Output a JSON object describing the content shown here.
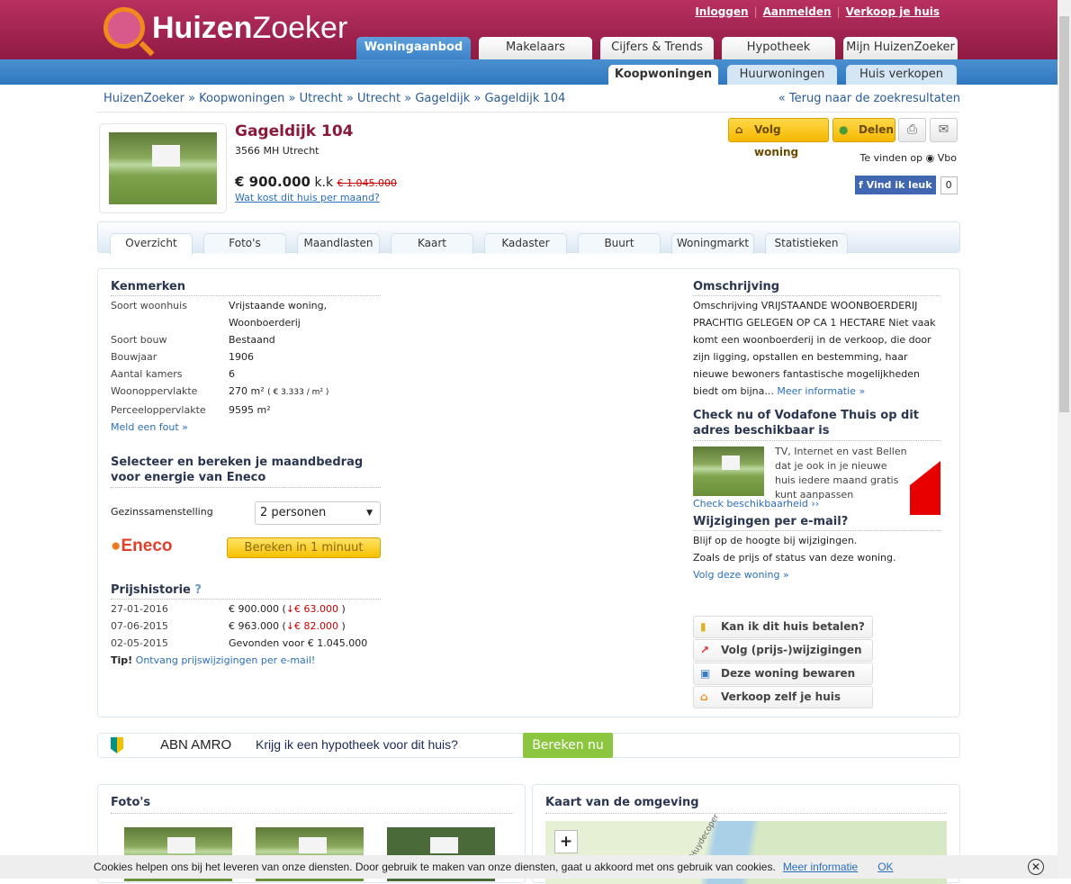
{
  "brand": {
    "name_bold": "Huizen",
    "name_rest": "Zoeker"
  },
  "top_links": [
    "Inloggen",
    "Aanmelden",
    "Verkoop je huis"
  ],
  "main_tabs": [
    "Woningaanbod",
    "Makelaars",
    "Cijfers & Trends",
    "Hypotheek",
    "Mijn HuizenZoeker"
  ],
  "sub_tabs": [
    "Koopwoningen",
    "Huurwoningen",
    "Huis verkopen"
  ],
  "breadcrumb": [
    "HuizenZoeker",
    "Koopwoningen",
    "Utrecht",
    "Utrecht",
    "Gageldijk",
    "Gageldijk 104"
  ],
  "back_link": "« Terug naar de zoekresultaten",
  "listing": {
    "title": "Gageldijk 104",
    "address": "3566 MH Utrecht",
    "price": "€ 900.000",
    "price_suffix": "k.k",
    "old_price": "€ 1.045.000",
    "monthly_link": "Wat kost dit huis per maand?"
  },
  "actions": {
    "follow": "Volg woning",
    "share": "Delen",
    "found_on": "Te vinden op",
    "source": "Vbo",
    "like": "Vind ik leuk",
    "like_count": "0"
  },
  "detail_tabs": [
    "Overzicht",
    "Foto's",
    "Maandlasten",
    "Kaart",
    "Kadaster",
    "Buurt",
    "Woningmarkt",
    "Statistieken"
  ],
  "kenmerken": {
    "heading": "Kenmerken",
    "rows": [
      {
        "k": "Soort woonhuis",
        "v": "Vrijstaande woning,"
      },
      {
        "k": "",
        "v": "Woonboerderij"
      },
      {
        "k": "Soort bouw",
        "v": "Bestaand"
      },
      {
        "k": "Bouwjaar",
        "v": "1906"
      },
      {
        "k": "Aantal kamers",
        "v": "6"
      },
      {
        "k": "Woonoppervlakte",
        "v": "270 m²",
        "extra": "( € 3.333 / m² )"
      },
      {
        "k": "Perceeloppervlakte",
        "v": "9595 m²"
      }
    ],
    "report_link": "Meld een fout »"
  },
  "energy": {
    "heading": "Selecteer en bereken je maandbedrag voor energie van Eneco",
    "label": "Gezinssamenstelling",
    "selected": "2 personen",
    "logo": "Eneco",
    "button": "Bereken in 1 minuut"
  },
  "history": {
    "heading": "Prijshistorie",
    "rows": [
      {
        "date": "27-01-2016",
        "price": "€ 900.000 (",
        "drop": "€ 63.000",
        "close": " )"
      },
      {
        "date": "07-06-2015",
        "price": "€ 963.000 (",
        "drop": "€ 82.000",
        "close": " )"
      },
      {
        "date": "02-05-2015",
        "price": "Gevonden voor € 1.045.000"
      }
    ],
    "tip_label": "Tip!",
    "tip_link": "Ontvang prijswijzigingen per e-mail!"
  },
  "description": {
    "heading": "Omschrijving",
    "text": "Omschrijving VRIJSTAANDE WOONBOERDERIJ PRACHTIG GELEGEN OP CA 1 HECTARE Niet vaak komt een woonboerderij in de verkoop, die door zijn ligging, opstallen en bestemming, haar nieuwe bewoners fantastische mogelijkheden biedt om bijna...",
    "more": "Meer informatie »"
  },
  "vodafone": {
    "heading": "Check nu of Vodafone Thuis op dit adres beschikbaar is",
    "text": "TV, Internet en vast Bellen dat je ook in je nieuwe huis iedere maand gratis kunt aanpassen",
    "link": "Check beschikbaarheid ››"
  },
  "email": {
    "heading": "Wijzigingen per e-mail?",
    "line1": "Blijf op de hoogte bij wijzigingen.",
    "line2": "Zoals de prijs of status van deze woning.",
    "link": "Volg deze woning »"
  },
  "side_buttons": [
    "Kan ik dit huis betalen?",
    "Volg (prijs-)wijzigingen",
    "Deze woning bewaren",
    "Verkoop zelf je huis"
  ],
  "abn": {
    "brand": "ABN AMRO",
    "question": "Krijg ik een hypotheek voor dit huis?",
    "button": "Bereken nu"
  },
  "photos_heading": "Foto's",
  "map": {
    "heading": "Kaart van de omgeving",
    "zoom_in": "+",
    "street": "Huydecoper"
  },
  "cookie": {
    "text": "Cookies helpen ons bij het leveren van onze diensten. Door gebruik te maken van onze diensten, gaat u akkoord met ons gebruik van cookies.",
    "more": "Meer informatie",
    "ok": "OK"
  },
  "colors": {
    "header": "#a32350",
    "nav_blue": "#3a82c8",
    "title": "#8b1a3a",
    "link": "#2a6ebb",
    "abn_green": "#8cc63f"
  }
}
